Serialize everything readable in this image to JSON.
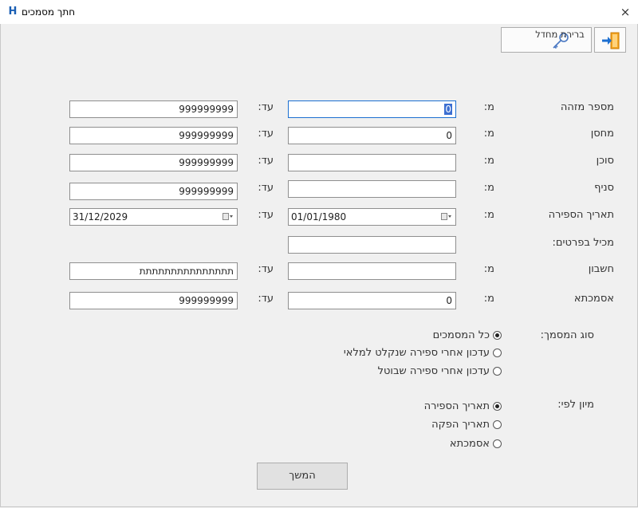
{
  "window": {
    "title": "חתך מסמכים",
    "close": "×"
  },
  "toolbar": {
    "password_label": "ברירת מחדל"
  },
  "labels": {
    "from": "מ:",
    "to": "עד:",
    "doc_number": "מספר מזהה",
    "warehouse": "מחסן",
    "agent": "סוכן",
    "branch": "סניף",
    "count_date": "תאריך הספירה",
    "contains": "מכיל בפרטים:",
    "account": "חשבון",
    "reference": "אסמכתא",
    "doc_type": "סוג המסמך:",
    "sort_by": "מיון לפי:"
  },
  "fields": {
    "doc_number_from": "0",
    "doc_number_to": "999999999",
    "warehouse_from": "0",
    "warehouse_to": "999999999",
    "agent_from": "",
    "agent_to": "999999999",
    "branch_from": "",
    "branch_to": "999999999",
    "date_from": "01/01/1980",
    "date_to": "31/12/2029",
    "contains": "",
    "account_from": "",
    "account_to": "תתתתתתתתתתתתתתת",
    "reference_from": "0",
    "reference_to": "999999999"
  },
  "doc_type_options": [
    {
      "label": "כל המסמכים",
      "selected": true
    },
    {
      "label": "עדכון אחרי ספירה שנקלט למלאי",
      "selected": false
    },
    {
      "label": "עדכון אחרי ספירה שבוטל",
      "selected": false
    }
  ],
  "sort_options": [
    {
      "label": "תאריך הספירה",
      "selected": true
    },
    {
      "label": "תאריך הפקה",
      "selected": false
    },
    {
      "label": "אסמכתא",
      "selected": false
    }
  ],
  "continue_label": "המשך",
  "colors": {
    "accent": "#1c6fd1",
    "exit_icon": "#f08c00",
    "logo": "#1a5fb4"
  }
}
